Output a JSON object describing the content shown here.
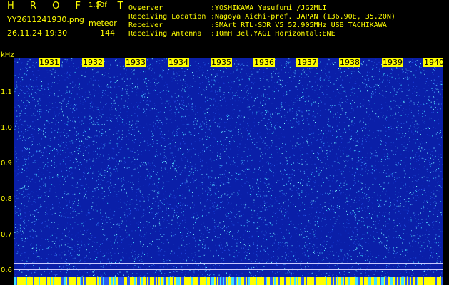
{
  "header": {
    "app_title": "H R O F F T",
    "app_version": "1.00f",
    "filename": "YY2611241930.png",
    "mode": "meteor",
    "timestamp": "26.11.24 19:30",
    "count": "144"
  },
  "info": [
    {
      "label": "Ovserver",
      "value": ":YOSHIKAWA Yasufumi /JG2MLI"
    },
    {
      "label": "Receiving Location",
      "value": ":Nagoya Aichi-pref. JAPAN (136.90E, 35.20N)"
    },
    {
      "label": "Receiver",
      "value": ":SMArt RTL-SDR V5 52.905MHz USB TACHIKAWA"
    },
    {
      "label": "Receiving Antenna",
      "value": ":10mH 3el.YAGI Horizontal:ENE"
    }
  ],
  "axis": {
    "y_unit": "kHz",
    "y_ticks": [
      "1.1",
      "1.0",
      "0.9",
      "0.8",
      "0.7",
      "0.6"
    ],
    "x_ticks": [
      "1931",
      "1932",
      "1933",
      "1934",
      "1935",
      "1936",
      "1937",
      "1938",
      "1939",
      "1940"
    ]
  },
  "colors": {
    "text": "#ffff00",
    "background": "#000000",
    "spectrogram_base": "#0a1fa8"
  }
}
